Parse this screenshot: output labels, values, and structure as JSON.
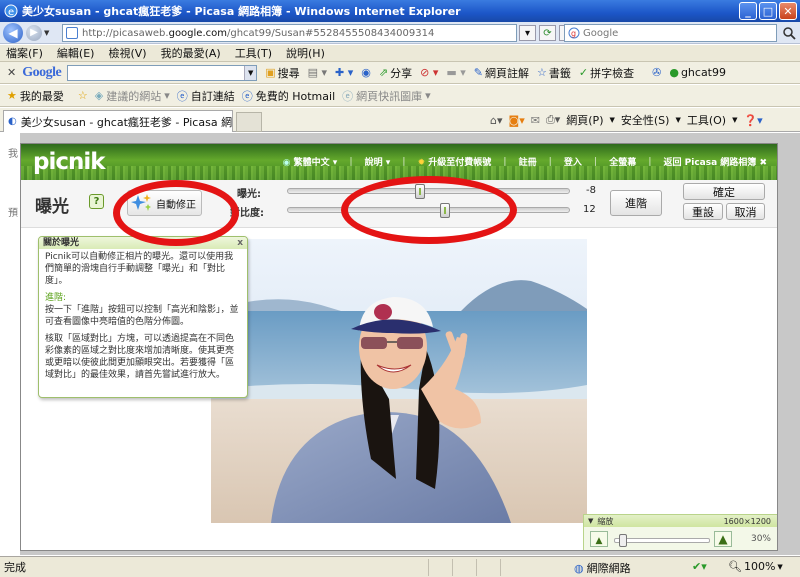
{
  "window": {
    "title": "美少女susan - ghcat瘋狂老爹 - Picasa 網路相簿 - Windows Internet Explorer",
    "minimize_glyph": "_",
    "maximize_glyph": "□",
    "close_glyph": "✕"
  },
  "address": {
    "url_prefix": "http://picasaweb.",
    "url_domain": "google.com",
    "url_suffix": "/ghcat99/Susan#5528455508434009314",
    "search_placeholder": "Google"
  },
  "menu": [
    "檔案(F)",
    "編輯(E)",
    "檢視(V)",
    "我的最愛(A)",
    "工具(T)",
    "說明(H)"
  ],
  "google_toolbar": {
    "logo": "Google",
    "items": [
      "搜尋",
      "分享",
      "網頁註解",
      "書籤",
      "拼字檢查"
    ],
    "user": "ghcat99"
  },
  "favorites": {
    "label": "我的最愛",
    "items": [
      "建議的網站",
      "自訂連結",
      "免費的 Hotmail",
      "網頁快訊圖庫"
    ]
  },
  "tab": {
    "title": "美少女susan - ghcat瘋狂老爹 - Picasa 網路相簿"
  },
  "tab_tools": [
    "網頁(P)",
    "安全性(S)",
    "工具(O)"
  ],
  "picnik": {
    "logo": "picnik",
    "nav": [
      "繁體中文",
      "說明",
      "升級至付費帳號",
      "註冊",
      "登入",
      "全螢幕",
      "返回 Picasa 網路相簿"
    ],
    "tool_title": "曝光",
    "help_q": "?",
    "autofix_label": "自動修正",
    "exposure": {
      "label": "曝光:",
      "value": "-8",
      "level": 0.47
    },
    "contrast": {
      "label": "對比度:",
      "value": "12",
      "level": 0.56
    },
    "advanced_label": "進階",
    "ok_label": "確定",
    "reset_label": "重設",
    "cancel_label": "取消",
    "help_box": {
      "title": "關於曝光",
      "close": "x",
      "p1": "Picnik可以自動修正相片的曝光。還可以使用我們簡單的滑塊自行手動調整「曝光」和「對比度」。",
      "p2_title": "進階:",
      "p2": "按一下「進階」按鈕可以控制「高光和陰影」，並可查看圖像中亮暗值的色階分佈圖。",
      "p3": "核取「區域對比」方塊，可以透過提高在不同色彩像素的區域之對比度來增加清晰度。使其更亮或更暗以使彼此間更加顯眼突出。若要獲得「區域對比」的最佳效果，請首先嘗試進行放大。"
    },
    "zoom": {
      "label": "縮放",
      "dims": "1600×1200",
      "percent": "30%",
      "level": 0.05
    }
  },
  "left_strip": [
    "我",
    "預"
  ],
  "status": {
    "left": "完成",
    "zone": "網際網路",
    "zoom": "100%"
  },
  "colors": {
    "ie_blue": "#1c56c8",
    "picnik_green": "#4f8f26",
    "annotation_red": "#e41414"
  }
}
